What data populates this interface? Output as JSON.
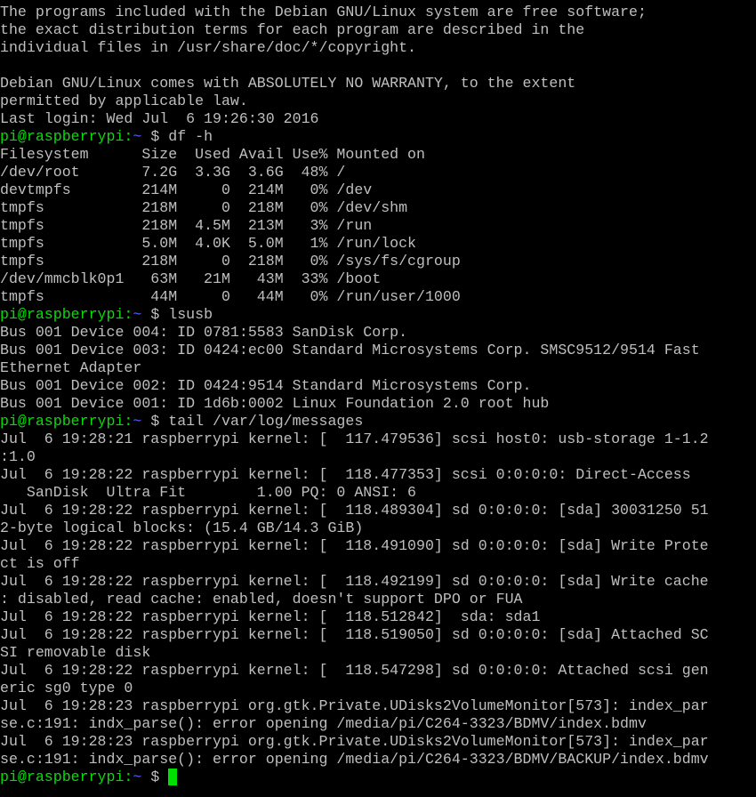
{
  "prompt": {
    "user_host": "pi@raspberrypi",
    "separator": ":",
    "path": "~",
    "symbol": " $ "
  },
  "colors": {
    "background": "#000000",
    "text": "#bfbfbf",
    "prompt_user": "#00e000",
    "prompt_path": "#5c5cff",
    "cursor": "#00e000"
  },
  "lines": [
    {
      "type": "text",
      "text": "The programs included with the Debian GNU/Linux system are free software;"
    },
    {
      "type": "text",
      "text": "the exact distribution terms for each program are described in the"
    },
    {
      "type": "text",
      "text": "individual files in /usr/share/doc/*/copyright."
    },
    {
      "type": "text",
      "text": ""
    },
    {
      "type": "text",
      "text": "Debian GNU/Linux comes with ABSOLUTELY NO WARRANTY, to the extent"
    },
    {
      "type": "text",
      "text": "permitted by applicable law."
    },
    {
      "type": "text",
      "text": "Last login: Wed Jul  6 19:26:30 2016"
    },
    {
      "type": "prompt",
      "command": "df -h"
    },
    {
      "type": "text",
      "text": "Filesystem      Size  Used Avail Use% Mounted on"
    },
    {
      "type": "text",
      "text": "/dev/root       7.2G  3.3G  3.6G  48% /"
    },
    {
      "type": "text",
      "text": "devtmpfs        214M     0  214M   0% /dev"
    },
    {
      "type": "text",
      "text": "tmpfs           218M     0  218M   0% /dev/shm"
    },
    {
      "type": "text",
      "text": "tmpfs           218M  4.5M  213M   3% /run"
    },
    {
      "type": "text",
      "text": "tmpfs           5.0M  4.0K  5.0M   1% /run/lock"
    },
    {
      "type": "text",
      "text": "tmpfs           218M     0  218M   0% /sys/fs/cgroup"
    },
    {
      "type": "text",
      "text": "/dev/mmcblk0p1   63M   21M   43M  33% /boot"
    },
    {
      "type": "text",
      "text": "tmpfs            44M     0   44M   0% /run/user/1000"
    },
    {
      "type": "prompt",
      "command": "lsusb"
    },
    {
      "type": "text",
      "text": "Bus 001 Device 004: ID 0781:5583 SanDisk Corp."
    },
    {
      "type": "text",
      "text": "Bus 001 Device 003: ID 0424:ec00 Standard Microsystems Corp. SMSC9512/9514 Fast"
    },
    {
      "type": "text",
      "text": "Ethernet Adapter"
    },
    {
      "type": "text",
      "text": "Bus 001 Device 002: ID 0424:9514 Standard Microsystems Corp."
    },
    {
      "type": "text",
      "text": "Bus 001 Device 001: ID 1d6b:0002 Linux Foundation 2.0 root hub"
    },
    {
      "type": "prompt",
      "command": "tail /var/log/messages"
    },
    {
      "type": "text",
      "text": "Jul  6 19:28:21 raspberrypi kernel: [  117.479536] scsi host0: usb-storage 1-1.2"
    },
    {
      "type": "text",
      "text": ":1.0"
    },
    {
      "type": "text",
      "text": "Jul  6 19:28:22 raspberrypi kernel: [  118.477353] scsi 0:0:0:0: Direct-Access"
    },
    {
      "type": "text",
      "text": "   SanDisk  Ultra Fit        1.00 PQ: 0 ANSI: 6"
    },
    {
      "type": "text",
      "text": "Jul  6 19:28:22 raspberrypi kernel: [  118.489304] sd 0:0:0:0: [sda] 30031250 51"
    },
    {
      "type": "text",
      "text": "2-byte logical blocks: (15.4 GB/14.3 GiB)"
    },
    {
      "type": "text",
      "text": "Jul  6 19:28:22 raspberrypi kernel: [  118.491090] sd 0:0:0:0: [sda] Write Prote"
    },
    {
      "type": "text",
      "text": "ct is off"
    },
    {
      "type": "text",
      "text": "Jul  6 19:28:22 raspberrypi kernel: [  118.492199] sd 0:0:0:0: [sda] Write cache"
    },
    {
      "type": "text",
      "text": ": disabled, read cache: enabled, doesn't support DPO or FUA"
    },
    {
      "type": "text",
      "text": "Jul  6 19:28:22 raspberrypi kernel: [  118.512842]  sda: sda1"
    },
    {
      "type": "text",
      "text": "Jul  6 19:28:22 raspberrypi kernel: [  118.519050] sd 0:0:0:0: [sda] Attached SC"
    },
    {
      "type": "text",
      "text": "SI removable disk"
    },
    {
      "type": "text",
      "text": "Jul  6 19:28:22 raspberrypi kernel: [  118.547298] sd 0:0:0:0: Attached scsi gen"
    },
    {
      "type": "text",
      "text": "eric sg0 type 0"
    },
    {
      "type": "text",
      "text": "Jul  6 19:28:23 raspberrypi org.gtk.Private.UDisks2VolumeMonitor[573]: index_par"
    },
    {
      "type": "text",
      "text": "se.c:191: indx_parse(): error opening /media/pi/C264-3323/BDMV/index.bdmv"
    },
    {
      "type": "text",
      "text": "Jul  6 19:28:23 raspberrypi org.gtk.Private.UDisks2VolumeMonitor[573]: index_par"
    },
    {
      "type": "text",
      "text": "se.c:191: indx_parse(): error opening /media/pi/C264-3323/BDMV/BACKUP/index.bdmv"
    },
    {
      "type": "prompt",
      "command": "",
      "cursor": true
    }
  ]
}
